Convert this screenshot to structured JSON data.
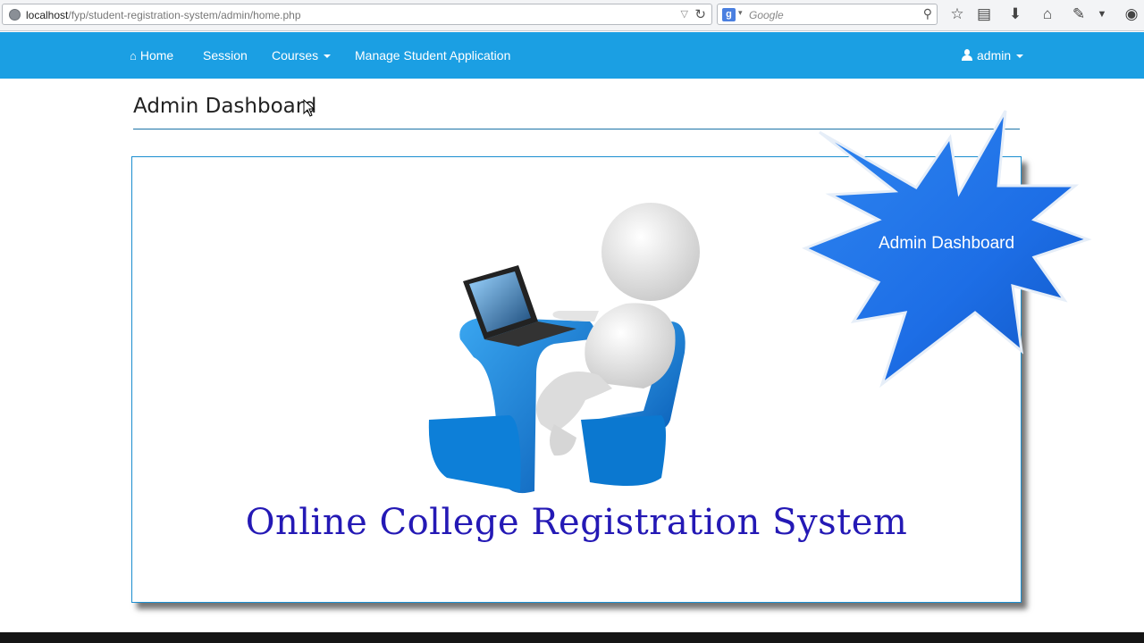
{
  "browser": {
    "url_host": "localhost",
    "url_path": "/fyp/student-registration-system/admin/home.php",
    "search_placeholder": "Google",
    "search_engine_letter": "g"
  },
  "navbar": {
    "home_label": "Home",
    "session_label": "Session",
    "courses_label": "Courses",
    "manage_label": "Manage Student Application",
    "user_label": "admin"
  },
  "main": {
    "page_title": "Admin Dashboard",
    "caption": "Online College Registration System",
    "starburst_label": "Admin Dashboard"
  },
  "colors": {
    "navbar": "#1b9fe3",
    "caption": "#2419b5",
    "starburst": "#1d6ee6"
  }
}
